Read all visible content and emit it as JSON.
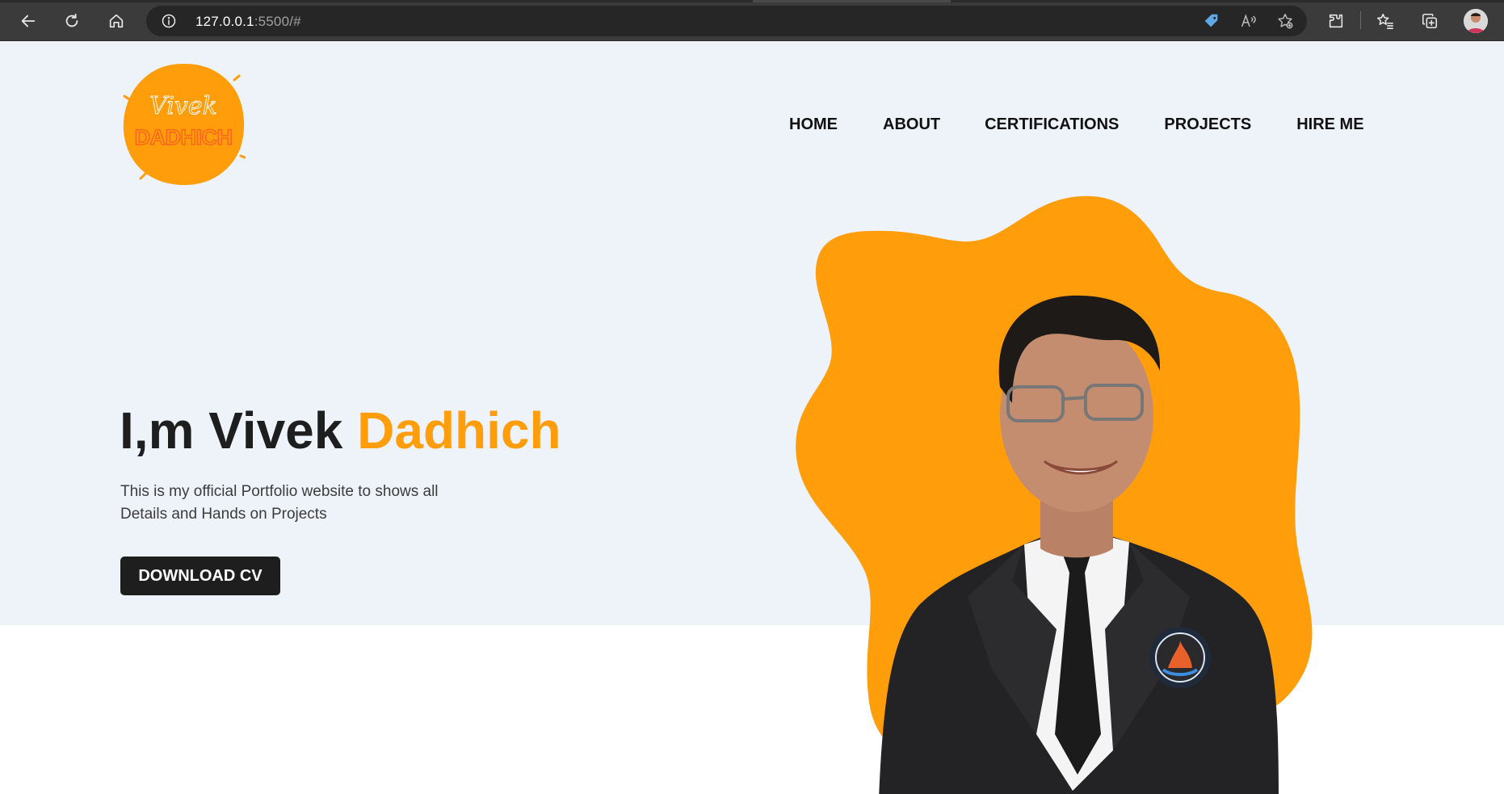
{
  "browser": {
    "url_host": "127.0.0.1",
    "url_rest": ":5500/#",
    "icons": [
      "back-icon",
      "refresh-icon",
      "home-icon",
      "info-icon",
      "price-tag-icon",
      "read-aloud-icon",
      "favorite-add-icon",
      "extensions-icon",
      "favorites-icon",
      "collections-icon",
      "profile-avatar"
    ]
  },
  "logo": {
    "line1": "Vivek",
    "line2": "DADHICH"
  },
  "nav": {
    "items": [
      "HOME",
      "ABOUT",
      "CERTIFICATIONS",
      "PROJECTS",
      "HIRE ME"
    ]
  },
  "hero": {
    "title_plain": "I,m Vivek ",
    "title_accent": "Dadhich",
    "subtitle_line1": "This is my official Portfolio website to shows all",
    "subtitle_line2": "Details and Hands on Projects",
    "button_label": "DOWNLOAD CV"
  },
  "colors": {
    "accent": "#ff9d0a",
    "hero_bg": "#eef3fa",
    "dark": "#1e1e1e"
  }
}
